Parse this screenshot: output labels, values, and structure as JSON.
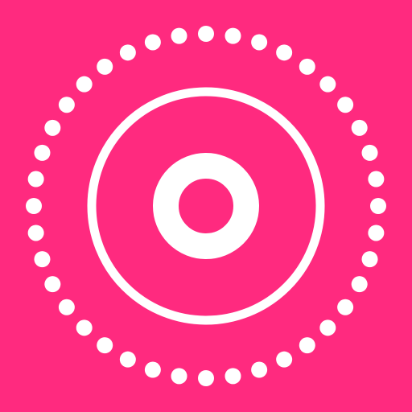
{
  "icon": {
    "name": "dotted-ring-target-icon",
    "background_color": "#ff2a7f",
    "foreground_color": "#ffffff",
    "dot_count": 40
  }
}
